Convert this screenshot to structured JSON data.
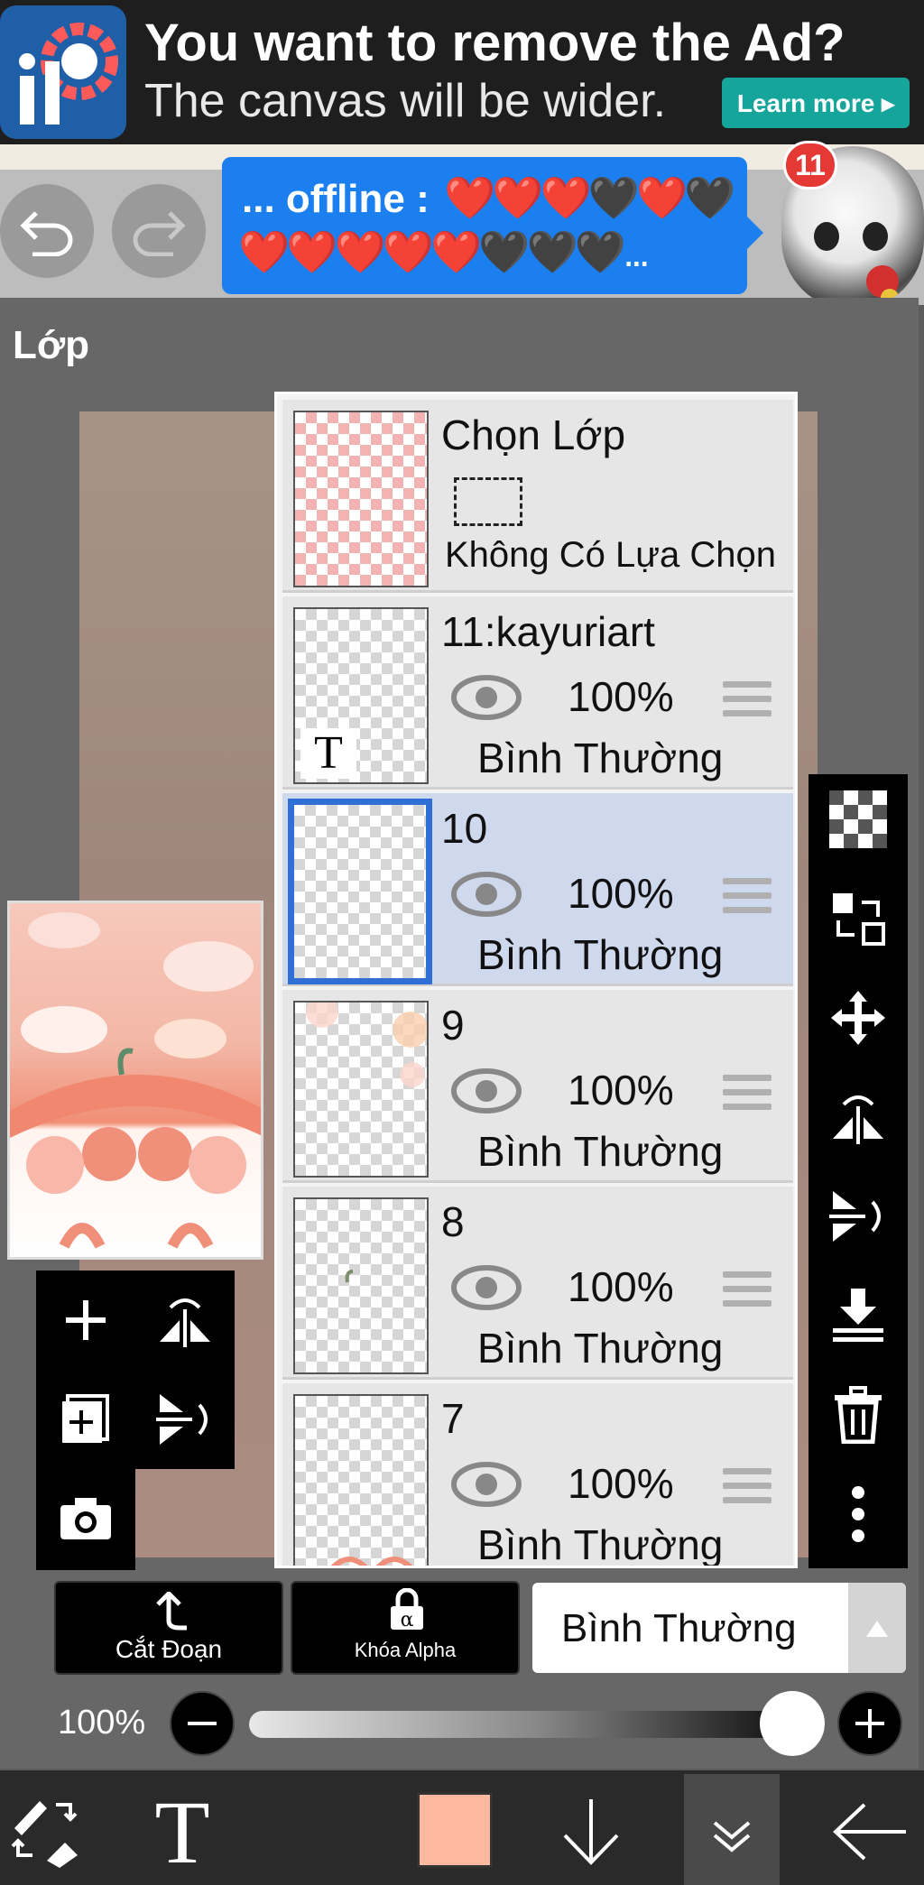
{
  "ad": {
    "title": "You want to remove the Ad?",
    "subtitle": "The canvas will be wider.",
    "button": "Learn more ▸"
  },
  "header": {
    "offline_label": "... offline :",
    "hearts_row1": "❤️❤️❤️🖤❤️🖤",
    "hearts_row2": "❤️❤️❤️❤️❤️🖤🖤🖤...",
    "notification_count": "11"
  },
  "panel": {
    "title": "Lớp",
    "selection_layer": {
      "name": "Chọn Lớp",
      "status": "Không Có Lựa Chọn"
    },
    "layers": [
      {
        "name": "11:kayuriart",
        "opacity": "100%",
        "blend": "Bình Thường",
        "text_marker": "T",
        "selected": false
      },
      {
        "name": "10",
        "opacity": "100%",
        "blend": "Bình Thường",
        "selected": true
      },
      {
        "name": "9",
        "opacity": "100%",
        "blend": "Bình Thường",
        "selected": false
      },
      {
        "name": "8",
        "opacity": "100%",
        "blend": "Bình Thường",
        "selected": false
      },
      {
        "name": "7",
        "opacity": "100%",
        "blend": "Bình Thường",
        "selected": false
      }
    ],
    "icons": {
      "right_tools": [
        "transparency-icon",
        "swap-icon",
        "move-icon",
        "flip-horizontal-icon",
        "flip-vertical-icon",
        "merge-down-icon",
        "trash-icon",
        "more-icon"
      ],
      "left_tools": [
        "add-layer-icon",
        "flip-horizontal-icon",
        "add-copy-icon",
        "flip-vertical-icon",
        "camera-icon"
      ]
    }
  },
  "controls": {
    "clipping_label": "Cắt Đoạn",
    "alpha_lock_label": "Khóa Alpha",
    "blend_mode": "Bình Thường",
    "opacity_label": "100%",
    "opacity_value": 1.0
  },
  "colors": {
    "brush_color": "#ffb9a1",
    "selected_border": "#2f6fd6",
    "ad_button": "#15a59b",
    "offline_bg": "#1b7ff0"
  }
}
